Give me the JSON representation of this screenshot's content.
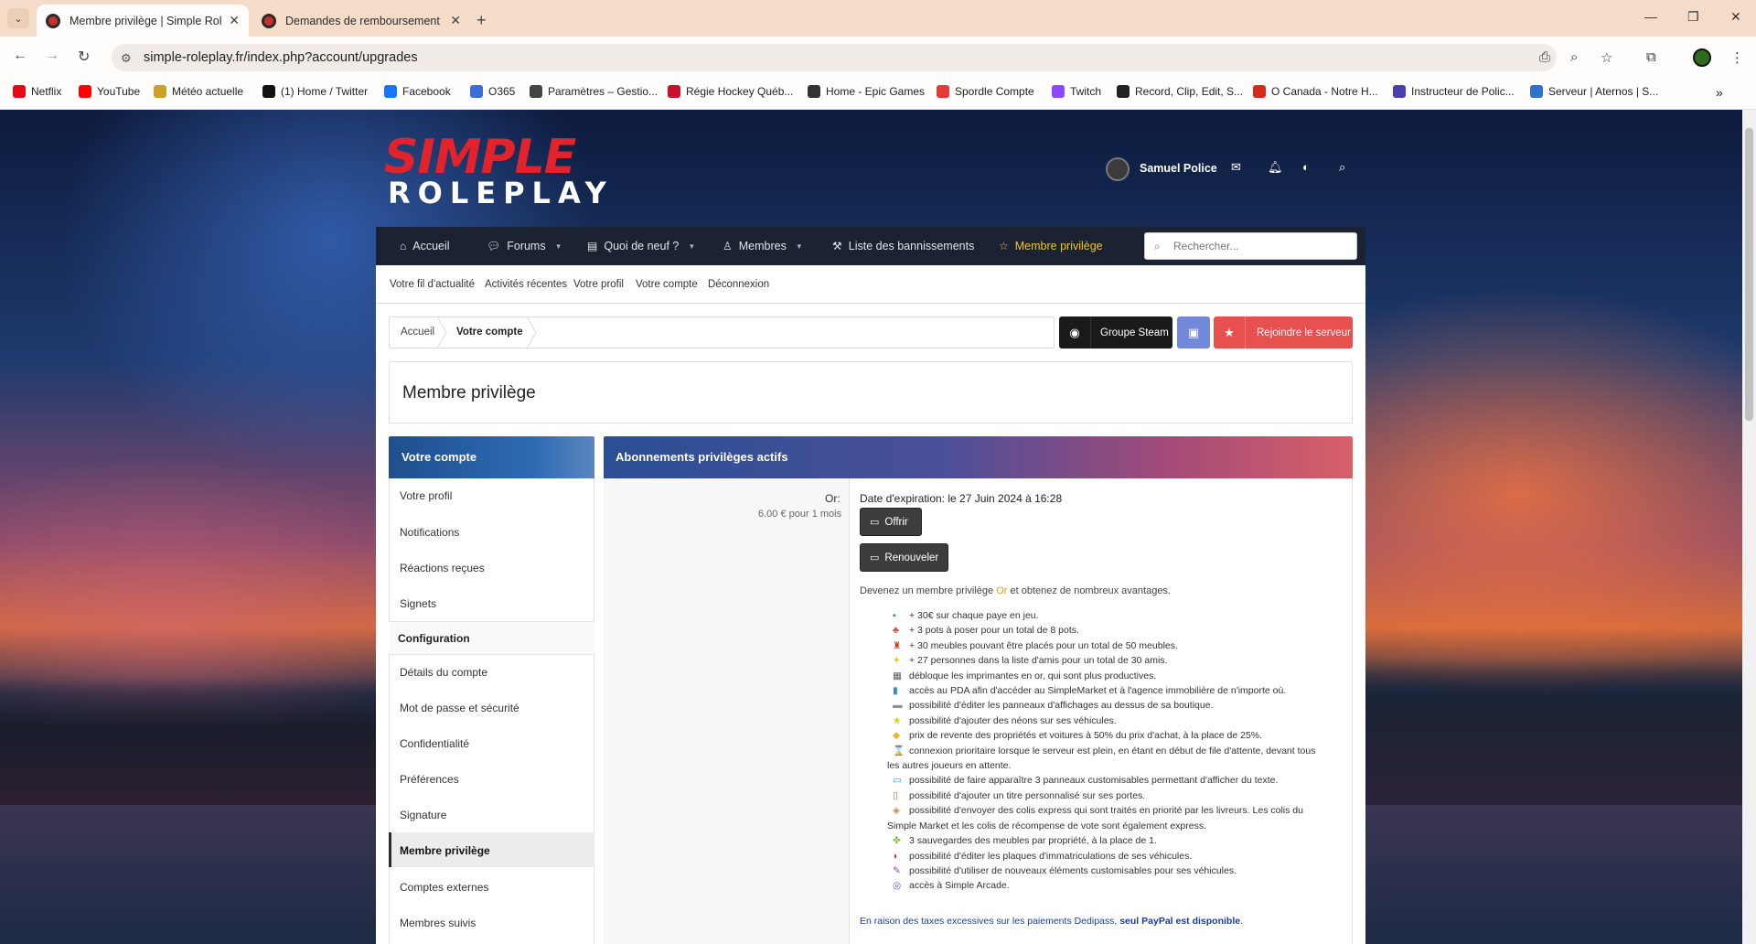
{
  "browser": {
    "tabs": [
      {
        "title": "Membre privilège | Simple Role",
        "active": true
      },
      {
        "title": "Demandes de remboursement",
        "active": false
      }
    ],
    "url": "simple-roleplay.fr/index.php?account/upgrades",
    "bookmarks": [
      {
        "label": "Netflix",
        "color": "#e50914"
      },
      {
        "label": "YouTube",
        "color": "#ff0000"
      },
      {
        "label": "Météo actuelle",
        "color": "#c9a227"
      },
      {
        "label": "(1) Home / Twitter",
        "color": "#111111"
      },
      {
        "label": "Facebook",
        "color": "#1877f2"
      },
      {
        "label": "O365",
        "color": "#3b6fd8"
      },
      {
        "label": "Paramètres – Gestio...",
        "color": "#444444"
      },
      {
        "label": "Régie Hockey Québ...",
        "color": "#c8102e"
      },
      {
        "label": "Home - Epic Games",
        "color": "#333333"
      },
      {
        "label": "Spordle Compte",
        "color": "#e53935"
      },
      {
        "label": "Twitch",
        "color": "#9146ff"
      },
      {
        "label": "Record, Clip, Edit, S...",
        "color": "#222222"
      },
      {
        "label": "O Canada - Notre H...",
        "color": "#d52b1e"
      },
      {
        "label": "Instructeur de Polic...",
        "color": "#4a3fb0"
      },
      {
        "label": "Serveur | Aternos | S...",
        "color": "#2f6fd0"
      }
    ]
  },
  "site": {
    "logo_top": "SIMPLE",
    "logo_bottom": "ROLEPLAY",
    "user_name": "Samuel Police",
    "nav": [
      {
        "label": "Accueil",
        "icon": "home-icon",
        "caret": false
      },
      {
        "label": "Forums",
        "icon": "comments-icon",
        "caret": true
      },
      {
        "label": "Quoi de neuf ?",
        "icon": "newspaper-icon",
        "caret": true
      },
      {
        "label": "Membres",
        "icon": "user-icon",
        "caret": true
      },
      {
        "label": "Liste des bannissements",
        "icon": "gavel-icon",
        "caret": false
      },
      {
        "label": "Membre privilège",
        "icon": "star-icon",
        "caret": false
      }
    ],
    "search_placeholder": "Rechercher...",
    "subnav": [
      "Votre fil d'actualité",
      "Activités récentes",
      "Votre profil",
      "Votre compte",
      "Déconnexion"
    ],
    "breadcrumb": [
      "Accueil",
      "Votre compte"
    ],
    "btn_steam": "Groupe Steam",
    "btn_join": "Rejoindre le serveur",
    "page_title": "Membre privilège"
  },
  "sidebar": {
    "title": "Votre compte",
    "items_top": [
      "Votre profil",
      "Notifications",
      "Réactions reçues",
      "Signets"
    ],
    "section": "Configuration",
    "items_config": [
      "Détails du compte",
      "Mot de passe et sécurité",
      "Confidentialité",
      "Préférences",
      "Signature",
      "Membre privilège",
      "Comptes externes",
      "Membres suivis"
    ],
    "active_item": "Membre privilège"
  },
  "main": {
    "title": "Abonnements privilèges actifs",
    "tier": "Or:",
    "price": "6.00 € pour 1 mois",
    "expiry": "Date d'expiration: le 27 Juin 2024 à 16:28",
    "btn_offer": "Offrir",
    "btn_renew": "Renouveler",
    "intro_before": "Devenez un membre privilège ",
    "intro_gold": "Or",
    "intro_after": " et obtenez de nombreux avantages.",
    "benefits": [
      {
        "icon": "money-icon",
        "color": "#2e9e4a",
        "text": "+ 30€ sur chaque paye en jeu."
      },
      {
        "icon": "plant-icon",
        "color": "#d9483b",
        "text": "+ 3 pots à poser pour un total de 8 pots."
      },
      {
        "icon": "chair-icon",
        "color": "#c0392b",
        "text": "+ 30 meubles pouvant être placés pour un total de 50 meubles."
      },
      {
        "icon": "sparkle-icon",
        "color": "#f1c40f",
        "text": "+ 27 personnes dans la liste d'amis pour un total de 30 amis."
      },
      {
        "icon": "printer-icon",
        "color": "#555555",
        "text": "débloque les imprimantes en or, qui sont plus productives."
      },
      {
        "icon": "tablet-icon",
        "color": "#3a86c8",
        "text": "accès au PDA afin d'accéder au SimpleMarket et à l'agence immobilière de n'importe où."
      },
      {
        "icon": "billboard-icon",
        "color": "#8e8e8e",
        "text": "possibilité d'éditer les panneaux d'affichages au dessus de sa boutique."
      },
      {
        "icon": "star-icon",
        "color": "#f1c40f",
        "text": "possibilité d'ajouter des néons sur ses véhicules."
      },
      {
        "icon": "tag-icon",
        "color": "#f0b429",
        "text": "prix de revente des propriétés et voitures à 50% du prix d'achat, à la place de 25%."
      },
      {
        "icon": "hourglass-icon",
        "color": "#b7950b",
        "text": "connexion prioritaire lorsque le serveur est plein, en étant en début de file d'attente, devant tous"
      },
      {
        "icon": "",
        "color": "",
        "text": "les autres joueurs en attente."
      },
      {
        "icon": "screen-icon",
        "color": "#3a9ad9",
        "text": "possibilité de faire apparaître 3 panneaux customisables permettant d'afficher du texte."
      },
      {
        "icon": "door-icon",
        "color": "#c97b2c",
        "text": "possibilité d'ajouter un titre personnalisé sur ses portes."
      },
      {
        "icon": "package-icon",
        "color": "#d4883a",
        "text": "possibilité d'envoyer des colis express qui sont traités en priorité par les livreurs. Les colis du"
      },
      {
        "icon": "",
        "color": "",
        "text": "Simple Market et les colis de récompense de vote sont également express."
      },
      {
        "icon": "puzzle-icon",
        "color": "#7cc242",
        "text": "3 sauvegardes des meubles par propriété, à la place de 1."
      },
      {
        "icon": "car-icon",
        "color": "#c0392b",
        "text": "possibilité d'éditer les plaques d'immatriculations de ses véhicules."
      },
      {
        "icon": "paint-icon",
        "color": "#8e44ad",
        "text": "possibilité d'utiliser de nouveaux éléments customisables pour ses véhicules."
      },
      {
        "icon": "gamepad-icon",
        "color": "#5b4fa8",
        "text": "accès à Simple Arcade."
      }
    ],
    "footnote_before": "En raison des taxes excessives sur les paiements Dedipass, ",
    "footnote_bold": "seul PayPal est disponible",
    "footnote_after": "."
  }
}
